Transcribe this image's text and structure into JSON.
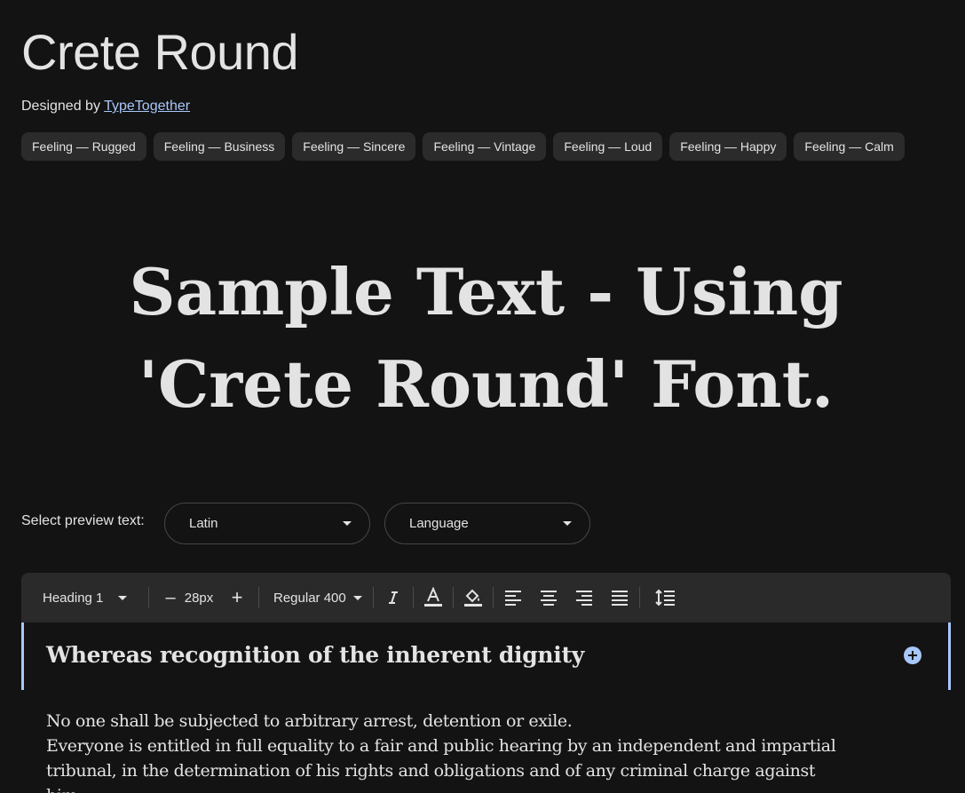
{
  "font": {
    "name": "Crete Round",
    "designed_by_prefix": "Designed by",
    "designer": "TypeTogether"
  },
  "tags": [
    "Feeling — Rugged",
    "Feeling — Business",
    "Feeling — Sincere",
    "Feeling — Vintage",
    "Feeling — Loud",
    "Feeling — Happy",
    "Feeling — Calm"
  ],
  "sample_text": "Sample Text - Using 'Crete Round' Font.",
  "preview": {
    "label": "Select preview text:",
    "script_value": "Latin",
    "language_value": "Language"
  },
  "toolbar": {
    "style": "Heading 1",
    "size": "28px",
    "decrease_symbol": "–",
    "increase_symbol": "+",
    "weight": "Regular 400",
    "icons": [
      "italic-icon",
      "text-color-icon",
      "highlight-icon",
      "align-left-icon",
      "align-center-icon",
      "align-right-icon",
      "align-justify-icon",
      "line-height-icon"
    ]
  },
  "editor": {
    "heading": "Whereas recognition of the inherent dignity",
    "paragraphs": [
      "No one shall be subjected to arbitrary arrest, detention or exile.",
      "Everyone is entitled in full equality to a fair and public hearing by an independent and impartial tribunal, in the determination of his rights and obligations and of any criminal charge against him."
    ]
  },
  "colors": {
    "background": "#131313",
    "chip": "#2b2b2b",
    "toolbar": "#2a2a2a",
    "accent": "#a8c7fa"
  }
}
